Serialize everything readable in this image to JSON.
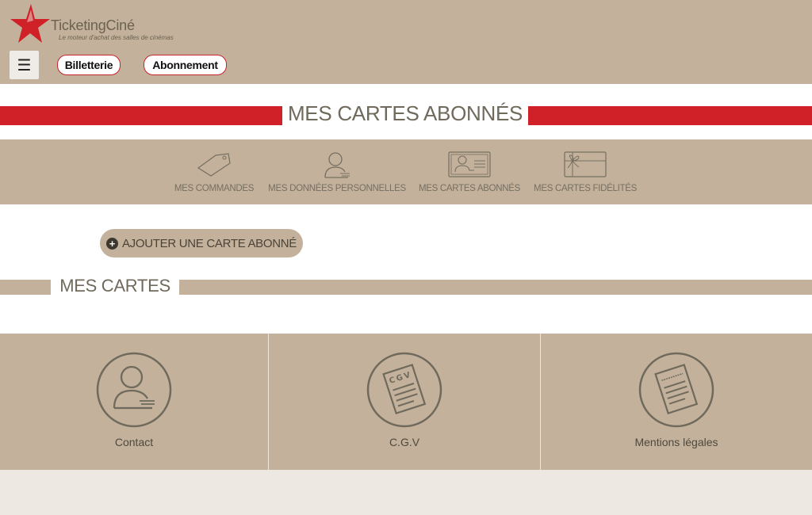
{
  "header": {
    "brand": "TicketingCiné",
    "tagline": "Le moteur d'achat des salles de cinémas",
    "menu_icon": "hamburger-icon",
    "nav": [
      {
        "label": "Billetterie"
      },
      {
        "label": "Abonnement"
      }
    ]
  },
  "page": {
    "title": "MES CARTES ABONNÉS"
  },
  "account_nav": [
    {
      "label": "MES COMMANDES",
      "icon": "tag-icon"
    },
    {
      "label": "MES DONNÉES PERSONNELLES",
      "icon": "user-icon"
    },
    {
      "label": "MES CARTES ABONNÉS",
      "icon": "id-card-icon"
    },
    {
      "label": "MES CARTES FIDÉLITÉS",
      "icon": "gift-card-icon"
    }
  ],
  "actions": {
    "add_card": "AJOUTER UNE CARTE ABONNÉ"
  },
  "section": {
    "title": "MES CARTES"
  },
  "footer": [
    {
      "label": "Contact",
      "icon": "contact-icon"
    },
    {
      "label": "C.G.V",
      "icon": "cgv-document-icon"
    },
    {
      "label": "Mentions légales",
      "icon": "legal-document-icon"
    }
  ],
  "colors": {
    "brand_red": "#cf2127",
    "beige": "#c3b19b",
    "text_olive": "#6f6a5b"
  }
}
